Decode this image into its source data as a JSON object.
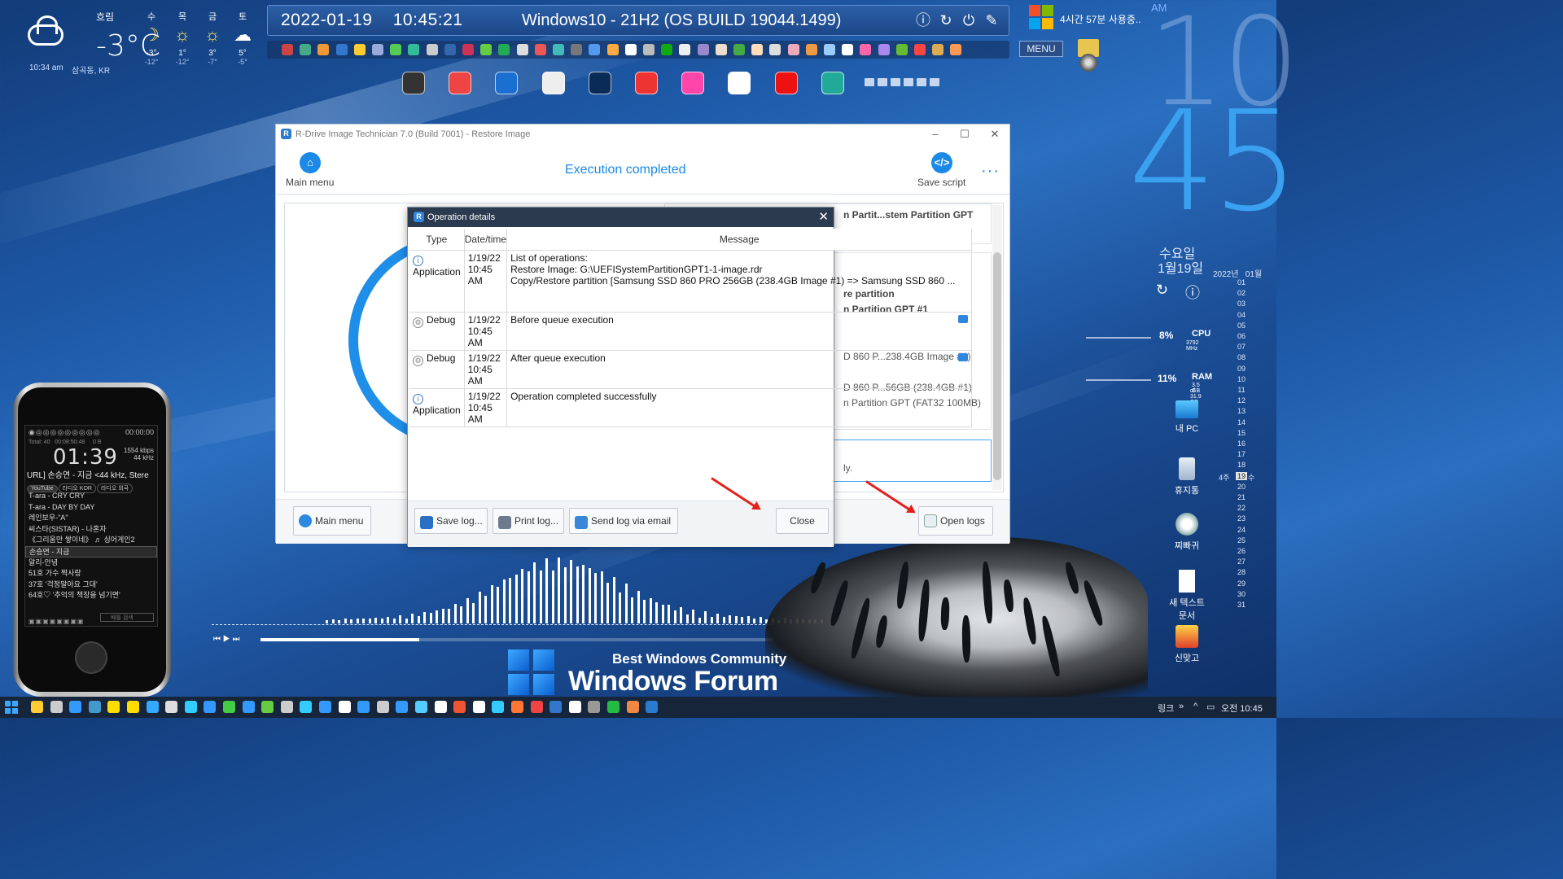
{
  "weather": {
    "condition": "흐림",
    "temperature": "-3°C",
    "updated": "10:34 am",
    "location": "삼곡동, KR",
    "forecast": [
      {
        "day": "수",
        "icon": "moon-icon",
        "high": "-3°",
        "low": "-12°"
      },
      {
        "day": "목",
        "icon": "sun-icon",
        "high": "1°",
        "low": "-12°"
      },
      {
        "day": "금",
        "icon": "sun-icon",
        "high": "3°",
        "low": "-7°"
      },
      {
        "day": "토",
        "icon": "cloud-icon",
        "high": "5°",
        "low": "-5°"
      }
    ]
  },
  "topbar": {
    "datetime": "2022-01-19    10:45:21",
    "os": "Windows10 - 21H2 (OS BUILD 19044.1499)"
  },
  "usage": {
    "text": "4시간 57분 사용중.."
  },
  "menu_button": "MENU",
  "clock": {
    "ampm": "AM",
    "hour": "10",
    "minute": "45",
    "weekday": "수요일",
    "date": "1월19일"
  },
  "calendar": {
    "header": "2022년   01월",
    "days": [
      "01",
      "02",
      "03",
      "04",
      "05",
      "06",
      "07",
      "08",
      "09",
      "10",
      "11",
      "12",
      "13",
      "14",
      "15",
      "16",
      "17",
      "18",
      "19",
      "20",
      "21",
      "22",
      "23",
      "24",
      "25",
      "26",
      "27",
      "28",
      "29",
      "30",
      "31"
    ],
    "today": "19",
    "week_label": "4주",
    "weekday_label": "수"
  },
  "meters": {
    "cpu": {
      "percent": "8%",
      "label": "CPU",
      "sub": "3792 MHz"
    },
    "ram": {
      "percent": "11%",
      "label": "RAM",
      "sub1": "3.5 GB",
      "sub2": "of 31.9 GB"
    }
  },
  "desktop_icons": [
    {
      "label": "내 PC",
      "icon": "pc-icon"
    },
    {
      "label": "휴지통",
      "icon": "recycle-bin-icon"
    },
    {
      "label": "찌빠귀",
      "icon": "app-icon"
    },
    {
      "label": "새 텍스트 문서",
      "icon": "text-file-icon"
    },
    {
      "label": "신맞고",
      "icon": "game-icon"
    }
  ],
  "player": {
    "time_display": "00:00:00",
    "total": "Total: 40",
    "total_time": "00:08:50:48",
    "size": "0 B",
    "clock": "01:39",
    "bitrate": "1554 kbps",
    "sample": "44 kHz",
    "track": "URL] 손승연 - 지금 <44 kHz, Stere",
    "chips": [
      "YouTube",
      "라디오 KOR",
      "라디오 외국"
    ],
    "playlist": [
      "T-ara - CRY CRY",
      "T-ara - DAY BY DAY",
      "레인보우-\"A\"",
      "씨스타(SISTAR) - 나혼자",
      "《그리움만 쌓이네》 ♬ 싱어게인2",
      "손승연 - 지금",
      "알리-안녕",
      "51호 가수 짝사랑",
      "37호 '걱정말아요 그대'",
      "64호♡ '추억의 책장을 넘기면'"
    ],
    "selected_index": 5,
    "search_placeholder": "배틀 검색"
  },
  "visualizer": {
    "progress": 0.31
  },
  "forum": {
    "tagline": "Best Windows Community",
    "name": "Windows Forum"
  },
  "app": {
    "title": "R-Drive Image Technician 7.0 (Build 7001) - Restore Image",
    "main_menu": "Main menu",
    "status": "Execution completed",
    "save_script": "Save script",
    "summary_lines": [
      "n Partit...stem Partition GPT",
      "re partition",
      "n Partition GPT #1",
      "D 860 P...238.4GB Image #1)",
      "D 860 P...56GB (238.4GB #1)",
      "n Partition GPT (FAT32 100MB)",
      "ly."
    ],
    "footer_main_menu": "Main menu",
    "open_logs": "Open logs"
  },
  "dialog": {
    "title": "Operation details",
    "columns": [
      "Type",
      "Date/time",
      "Message"
    ],
    "rows": [
      {
        "type": "Application",
        "icon": "info-icon",
        "datetime": "1/19/22 10:45 AM",
        "message": "List of operations:\nRestore Image: G:\\UEFISystemPartitionGPT1-1-image.rdr\nCopy/Restore partition [Samsung SSD 860 PRO 256GB (238.4GB Image #1) => Samsung SSD 860 ...",
        "bubble": false
      },
      {
        "type": "Debug",
        "icon": "gear-icon",
        "datetime": "1/19/22 10:45 AM",
        "message": "Before queue execution",
        "bubble": true
      },
      {
        "type": "Debug",
        "icon": "gear-icon",
        "datetime": "1/19/22 10:45 AM",
        "message": "After queue execution",
        "bubble": true
      },
      {
        "type": "Application",
        "icon": "info-icon",
        "datetime": "1/19/22 10:45 AM",
        "message": "Operation completed successfully",
        "bubble": false
      }
    ],
    "buttons": {
      "save_log": "Save log...",
      "print_log": "Print log...",
      "send_log": "Send log via email",
      "close": "Close"
    }
  },
  "taskbar": {
    "links": "링크",
    "clock": "오전 10:45"
  }
}
